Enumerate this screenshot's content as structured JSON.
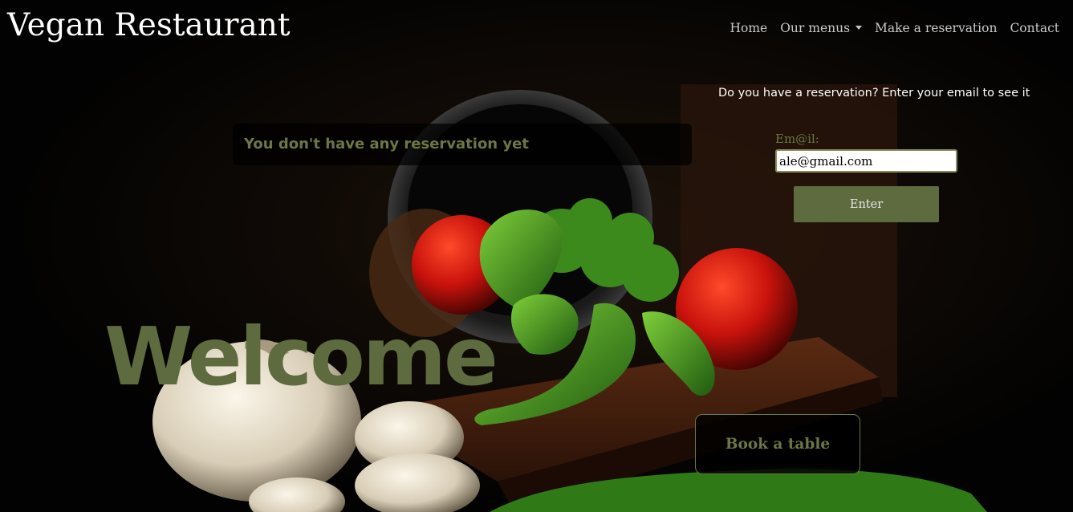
{
  "header": {
    "brand": "Vegan Restaurant",
    "nav": [
      {
        "label": "Home"
      },
      {
        "label": "Our menus"
      },
      {
        "label": "Make a reservation"
      },
      {
        "label": "Contact"
      }
    ]
  },
  "lookup": {
    "prompt": "Do you have a reservation? Enter your email to see it",
    "email_label": "Em@il:",
    "email_value": "ale@gmail.com",
    "enter_label": "Enter"
  },
  "reservations": {
    "empty_message": "You don't have any reservation yet"
  },
  "hero": {
    "headline": "Welcome",
    "book_label": "Book a table"
  },
  "colors": {
    "accent_olive": "#5d6b3e",
    "text_olive": "#6b7744",
    "background": "#030303"
  }
}
